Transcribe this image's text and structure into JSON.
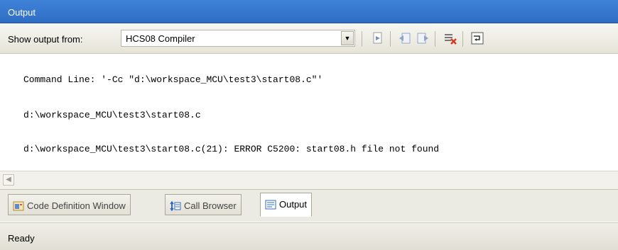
{
  "window": {
    "title": "Output"
  },
  "toolbar": {
    "show_label": "Show output from:",
    "source_value": "HCS08 Compiler",
    "buttons": [
      "go-to-line-icon",
      "find-previous-icon",
      "find-next-icon",
      "clear-all-icon",
      "word-wrap-icon"
    ]
  },
  "output": {
    "lines": [
      "Command Line: '-Cc \"d:\\workspace_MCU\\test3\\start08.c\"'",
      "d:\\workspace_MCU\\test3\\start08.c",
      "d:\\workspace_MCU\\test3\\start08.c(21): ERROR C5200: start08.h file not found"
    ]
  },
  "tabs": [
    {
      "label": "Code Definition Window",
      "icon": "code-definition-icon",
      "active": false
    },
    {
      "label": "Call Browser",
      "icon": "call-browser-icon",
      "active": false
    },
    {
      "label": "Output",
      "icon": "output-icon",
      "active": true
    }
  ],
  "status": {
    "text": "Ready"
  },
  "colors": {
    "title_bar": "#3175d0",
    "toolbar": "#eeede5",
    "active_tab": "#ffffff"
  }
}
